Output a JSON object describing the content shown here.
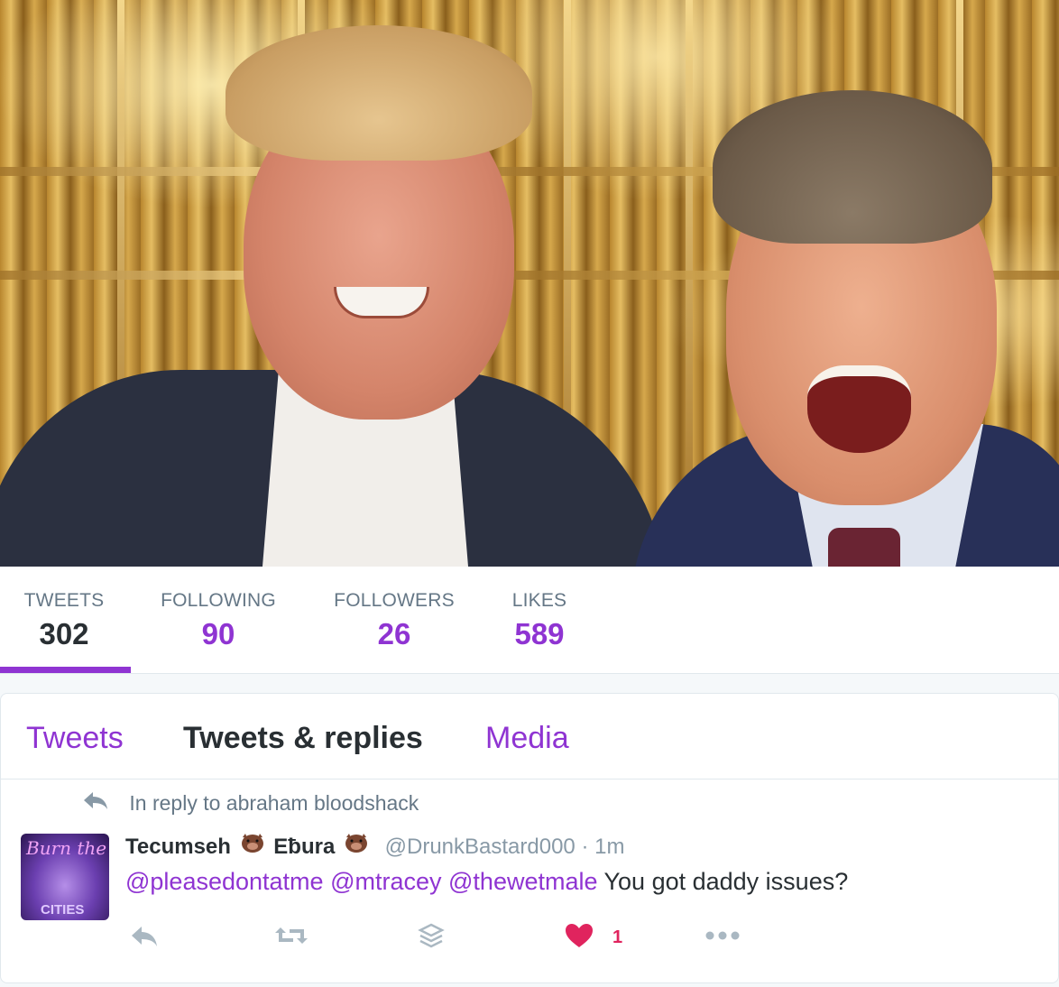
{
  "profile_nav": {
    "stats": [
      {
        "label": "TWEETS",
        "value": "302"
      },
      {
        "label": "FOLLOWING",
        "value": "90"
      },
      {
        "label": "FOLLOWERS",
        "value": "26"
      },
      {
        "label": "LIKES",
        "value": "589"
      }
    ]
  },
  "tabs": [
    {
      "label": "Tweets"
    },
    {
      "label": "Tweets & replies"
    },
    {
      "label": "Media"
    }
  ],
  "tweet": {
    "context": "In reply to abraham bloodshack",
    "fullname_part1": "Tecumseh",
    "fullname_part2": "Eƀura",
    "username": "@DrunkBastard000",
    "time": "· 1m",
    "mentions": [
      "@pleasedontatme",
      "@mtracey",
      "@thewetmale"
    ],
    "text": "You got daddy issues?",
    "like_count": "1",
    "avatar_text_top": "Burn the",
    "avatar_text_bottom": "CITIES"
  },
  "colors": {
    "accent": "#8f34d2",
    "text": "#292f33",
    "muted": "#657786",
    "like": "#e0245e"
  },
  "icons": [
    "reply-icon",
    "retweet-icon",
    "stack-icon",
    "heart-icon",
    "more-icon",
    "boar-emoji-icon"
  ]
}
